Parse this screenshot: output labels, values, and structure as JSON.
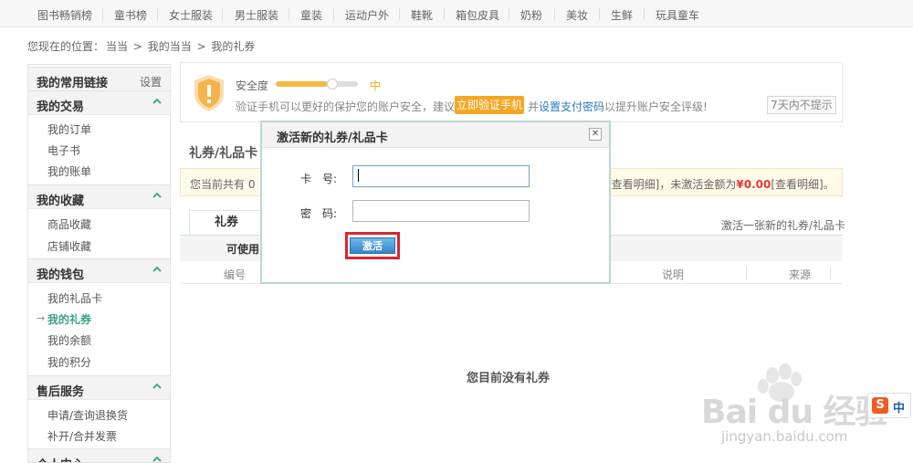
{
  "topnav": [
    "图书畅销榜",
    "童书榜",
    "女士服装",
    "男士服装",
    "童装",
    "运动户外",
    "鞋靴",
    "箱包皮具",
    "奶粉",
    "美妆",
    "生鲜",
    "玩具童车"
  ],
  "breadcrumb": {
    "prefix": "您现在的位置：",
    "l1": "当当",
    "l2": "我的当当",
    "l3": "我的礼券",
    "sep": " > "
  },
  "sidebar": {
    "fav_title": "我的常用链接",
    "fav_settings": "设置",
    "groups": [
      {
        "title": "我的交易",
        "items": [
          "我的订单",
          "电子书",
          "我的账单"
        ]
      },
      {
        "title": "我的收藏",
        "items": [
          "商品收藏",
          "店铺收藏"
        ]
      },
      {
        "title": "我的钱包",
        "items": [
          "我的礼品卡",
          "我的礼券",
          "我的余额",
          "我的积分"
        ]
      },
      {
        "title": "售后服务",
        "items": [
          "申请/查询退换货",
          "补开/合并发票"
        ]
      },
      {
        "title": "个人中心",
        "items": []
      }
    ],
    "active_item": "我的礼券"
  },
  "security": {
    "label": "安全度",
    "level": "中",
    "level_percent": 0.62,
    "msg": "验证手机可以更好的保护您的账户安全，建议您",
    "btn": "立即验证手机",
    "msg2a": "并",
    "msg2_link": "设置支付密码",
    "msg2b": "以提升账户安全评级!",
    "hide_btn": "7天内不提示"
  },
  "main": {
    "section_title": "礼券/礼品卡",
    "summary_left": "您当前共有 0",
    "summary_right_a": "[查看明细]，未激活金额为",
    "summary_right_amt": "¥0.00",
    "summary_right_b": "[查看明细]。",
    "tab": "礼券",
    "activate_link": "激活一张新的礼券/礼品卡",
    "subhead": "可使用",
    "columns": {
      "col1": "编号",
      "col2": "说明",
      "col3": "来源"
    },
    "empty": "您目前没有礼券"
  },
  "modal": {
    "title": "激活新的礼券/礼品卡",
    "card_label": "卡　号:",
    "card_value": "",
    "pwd_label": "密　码:",
    "pwd_value": "",
    "activate": "激活",
    "close": "✕"
  },
  "watermark": {
    "brand": "Bai du 经验",
    "url": "jingyan.baidu.com"
  },
  "ime": {
    "logo": "S",
    "mode": "中"
  },
  "colors": {
    "accent": "#3f9f8a",
    "warning": "#f5a623",
    "highlight": "#d9262f"
  }
}
